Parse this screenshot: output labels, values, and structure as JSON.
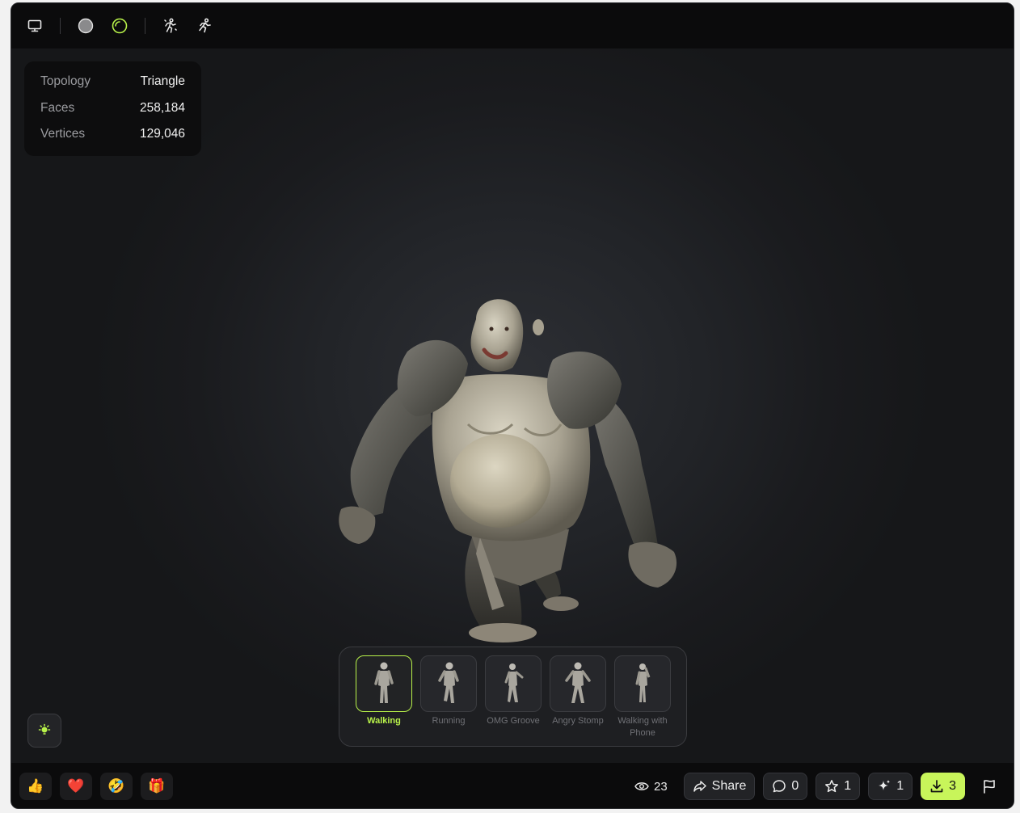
{
  "toolbar": {
    "icons": [
      "monitor-icon",
      "solid-sphere-icon",
      "rim-sphere-icon",
      "skeleton-icon",
      "animation-run-icon"
    ]
  },
  "stats": [
    {
      "label": "Topology",
      "value": "Triangle"
    },
    {
      "label": "Faces",
      "value": "258,184"
    },
    {
      "label": "Vertices",
      "value": "129,046"
    }
  ],
  "animations": {
    "selected": "Walking",
    "items": [
      {
        "label": "Walking"
      },
      {
        "label": "Running"
      },
      {
        "label": "OMG Groove"
      },
      {
        "label": "Angry Stomp"
      },
      {
        "label": "Walking with Phone"
      }
    ]
  },
  "footer": {
    "reactions": [
      "👍",
      "❤️",
      "🤣",
      "🎁"
    ],
    "views": "23",
    "share_label": "Share",
    "comments": "0",
    "stars": "1",
    "remix": "1",
    "downloads": "3"
  },
  "colors": {
    "accent": "#b8f24a",
    "download_bg": "#c8f55a",
    "background": "#16171a"
  }
}
